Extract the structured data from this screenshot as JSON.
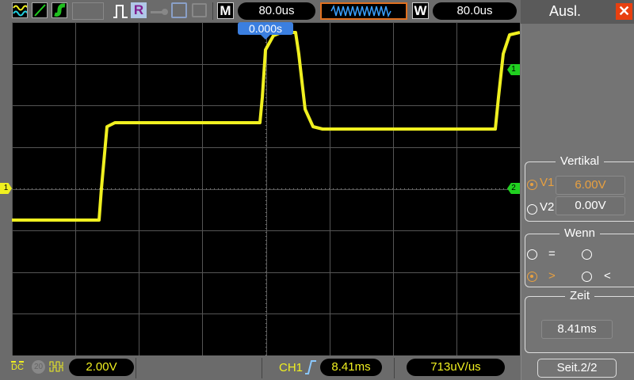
{
  "toolbar": {
    "timebase_label": "M",
    "timebase": "80.0us",
    "window_label": "W",
    "window_value": "80.0us",
    "trigger_pos": "0.000s",
    "run_label": "R"
  },
  "side": {
    "title": "Ausl.",
    "vertikal": {
      "title": "Vertikal",
      "v1_label": "V1",
      "v1": "6.00V",
      "v2_label": "V2",
      "v2": "0.00V"
    },
    "wenn": {
      "title": "Wenn",
      "eq": "=",
      "gt": ">",
      "lt": "<"
    },
    "zeit": {
      "title": "Zeit",
      "value": "8.41ms"
    },
    "page": "Seit.2/2"
  },
  "bottom": {
    "coupling": "DC",
    "bw": "20",
    "ch_scale": "2.00V",
    "trig_ch": "CH1",
    "trig_time": "8.41ms",
    "slope": "713uV/us"
  },
  "markers": {
    "ch1": "1",
    "cursor1": "1",
    "cursor2": "2"
  },
  "colors": {
    "ch1": "#f0f020",
    "accent": "#e8a040",
    "cursor": "#20d020",
    "trigger": "#3b7fe0"
  }
}
